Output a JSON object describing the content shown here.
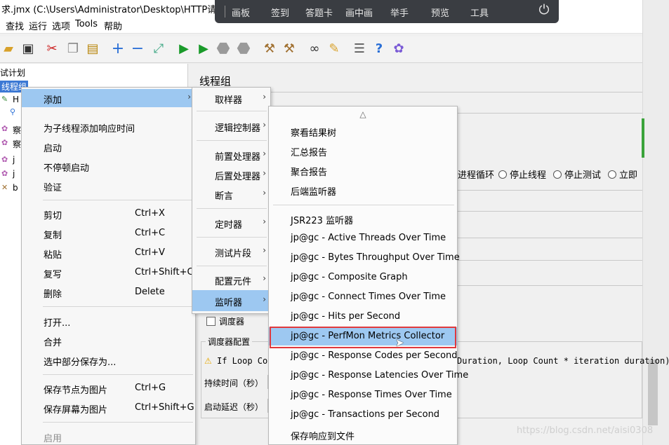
{
  "window": {
    "title": "求.jmx (C:\\Users\\Administrator\\Desktop\\HTTP请求.jmx"
  },
  "menubar": [
    "查找",
    "运行",
    "选项",
    "Tools",
    "帮助"
  ],
  "toolbar_icons": [
    "open-icon",
    "save-icon",
    "cut-icon",
    "copy-icon",
    "paste-icon",
    "expand-icon",
    "collapse-icon",
    "toggle-icon",
    "start-icon",
    "start-no-pause-icon",
    "stop-icon",
    "shutdown-icon",
    "clear-icon",
    "clear-all-icon",
    "search-icon",
    "reset-search-icon",
    "function-helper-icon",
    "help-icon",
    "remote-icon"
  ],
  "floatbar": {
    "items": [
      "画板",
      "签到",
      "答题卡",
      "画中画",
      "举手",
      "预览",
      "工具"
    ]
  },
  "tree": {
    "items": [
      "试计划",
      "线程组",
      "H",
      "察",
      "察",
      "j",
      "j",
      "b"
    ]
  },
  "main": {
    "header": "线程组",
    "radios": [
      "进程循环",
      "停止线程",
      "停止测试",
      "立即"
    ],
    "scheduler_checkbox": "调度器",
    "scheduler_config_legend": "调度器配置",
    "warning_left": "If Loop Cour",
    "warning_right": "Duration, Loop Count * iteration duration)",
    "duration_label": "持续时间（秒）",
    "startup_delay_label": "启动延迟（秒）"
  },
  "context_menu": {
    "items": [
      {
        "label": "添加",
        "submenu": true,
        "highlight": true
      },
      {
        "label": "为子线程添加响应时间"
      },
      {
        "label": "启动"
      },
      {
        "label": "不停顿启动"
      },
      {
        "label": "验证"
      },
      {
        "label": "剪切",
        "shortcut": "Ctrl+X"
      },
      {
        "label": "复制",
        "shortcut": "Ctrl+C"
      },
      {
        "label": "粘贴",
        "shortcut": "Ctrl+V"
      },
      {
        "label": "复写",
        "shortcut": "Ctrl+Shift+C"
      },
      {
        "label": "删除",
        "shortcut": "Delete"
      },
      {
        "label": "打开..."
      },
      {
        "label": "合并"
      },
      {
        "label": "选中部分保存为..."
      },
      {
        "label": "保存节点为图片",
        "shortcut": "Ctrl+G"
      },
      {
        "label": "保存屏幕为图片",
        "shortcut": "Ctrl+Shift+G"
      },
      {
        "label": "启用",
        "disabled": true
      }
    ]
  },
  "add_submenu": {
    "items": [
      {
        "label": "取样器"
      },
      {
        "label": "逻辑控制器"
      },
      {
        "label": "前置处理器"
      },
      {
        "label": "后置处理器"
      },
      {
        "label": "断言"
      },
      {
        "label": "定时器"
      },
      {
        "label": "测试片段"
      },
      {
        "label": "配置元件"
      },
      {
        "label": "监听器",
        "highlight": true
      }
    ]
  },
  "listener_submenu": {
    "scroll_up": "△",
    "items": [
      "察看结果树",
      "汇总报告",
      "聚合报告",
      "后端监听器",
      "JSR223 监听器",
      "jp@gc - Active Threads Over Time",
      "jp@gc - Bytes Throughput Over Time",
      "jp@gc - Composite Graph",
      "jp@gc - Connect Times Over Time",
      "jp@gc - Hits per Second",
      "jp@gc - PerfMon Metrics Collector",
      "jp@gc - Response Codes per Second",
      "jp@gc - Response Latencies Over Time",
      "jp@gc - Response Times Over Time",
      "jp@gc - Transactions per Second",
      "保存响应到文件"
    ],
    "highlighted": "jp@gc - PerfMon Metrics Collector"
  },
  "watermark": "https://blog.csdn.net/aisi0308"
}
